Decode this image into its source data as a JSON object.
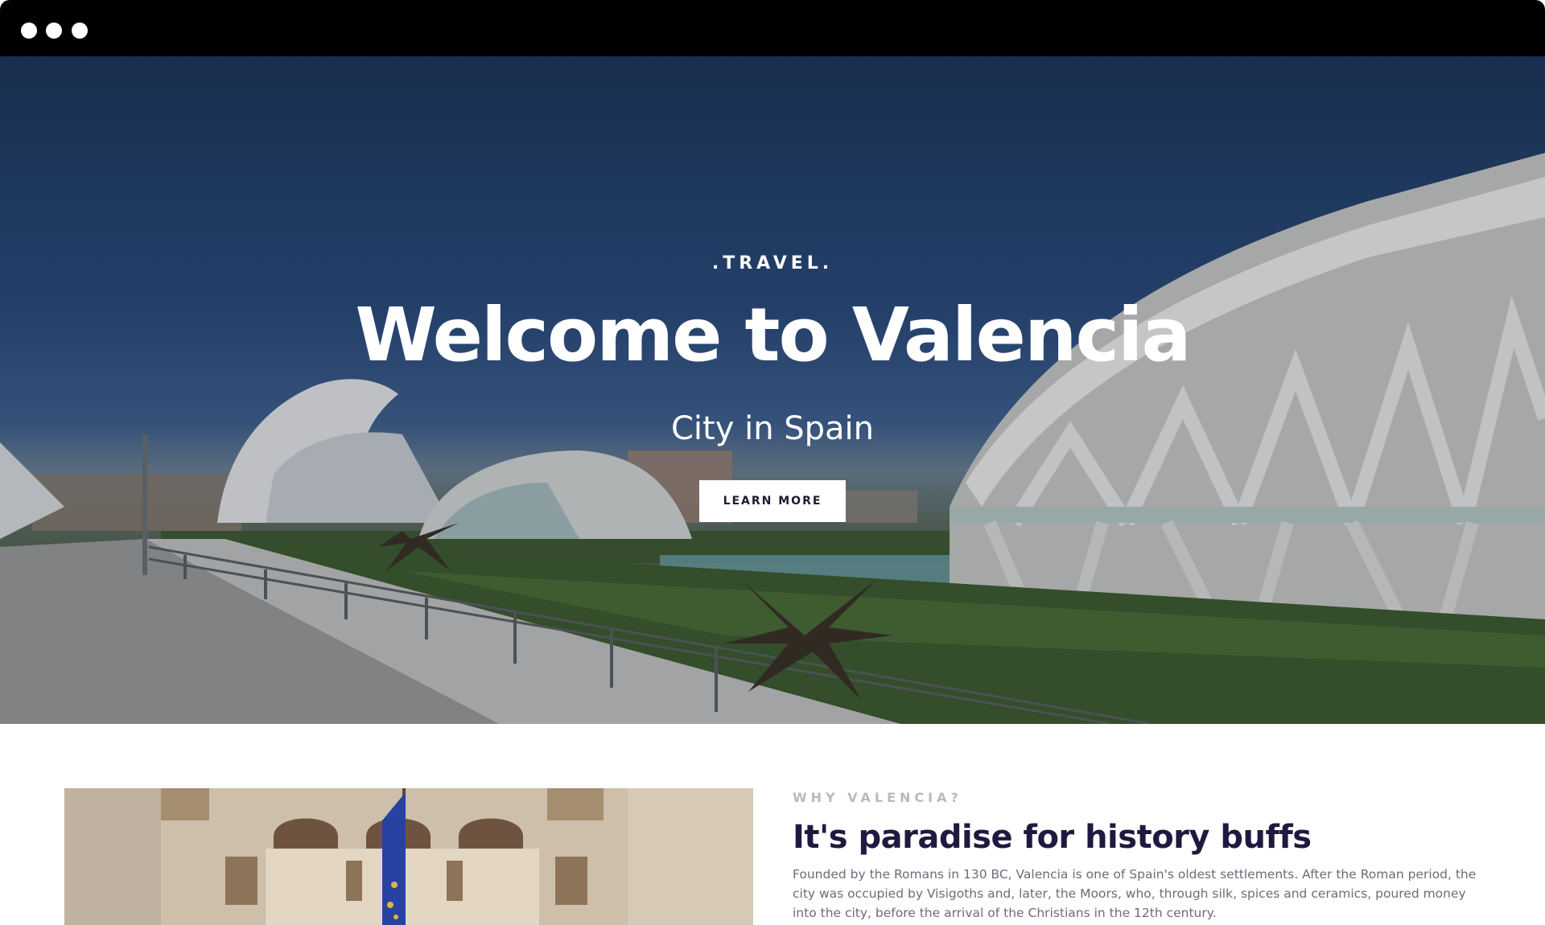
{
  "window": {
    "controls": [
      "window-dot-1",
      "window-dot-2",
      "window-dot-3"
    ]
  },
  "hero": {
    "eyebrow": ".TRAVEL.",
    "title": "Welcome to Valencia",
    "subtitle": "City in Spain",
    "cta_label": "LEARN MORE"
  },
  "about": {
    "kicker": "WHY VALENCIA?",
    "heading": "It's paradise for history buffs",
    "body": "Founded by the Romans in 130 BC, Valencia is one of Spain's oldest settlements. After the Roman period, the city was occupied by Visigoths and, later, the Moors, who, through silk, spices and ceramics, poured money into the city, before the arrival of the Christians in the 12th century."
  },
  "colors": {
    "titlebar": "#000000",
    "heading": "#1e1a3f",
    "kicker": "#b9b9c4",
    "body": "#6c6c7a",
    "button_bg": "#ffffff"
  }
}
